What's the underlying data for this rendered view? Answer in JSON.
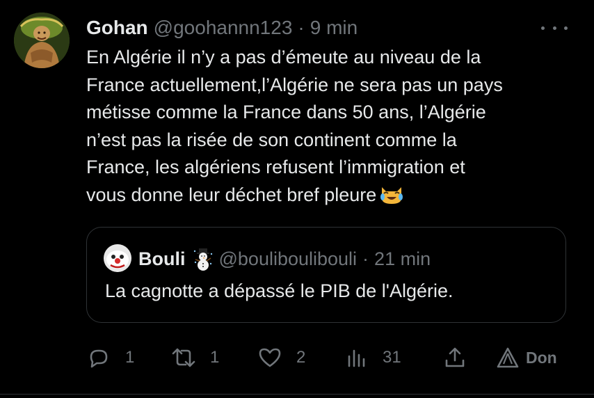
{
  "tweet": {
    "author_name": "Gohan",
    "author_handle": "@goohannn123",
    "separator": "·",
    "time": "9 min",
    "body_lines": [
      "En Algérie il n’y a pas d’émeute au niveau de la",
      "France actuellement,l’Algérie ne sera pas un pays",
      "métisse comme la France dans 50 ans, l’Algérie",
      "n’est pas la risée de son continent comme la",
      "France, les algériens refusent l’immigration et",
      "vous donne leur déchet bref pleure"
    ],
    "emoji": "tears-of-joy-cat-emoji"
  },
  "quote": {
    "author_name": "Bouli",
    "author_handle": "@bouliboulibouli",
    "separator": "·",
    "time": "21 min",
    "text": "La cagnotte a dépassé le PIB de l'Algérie."
  },
  "actions": {
    "replies": "1",
    "retweets": "1",
    "likes": "2",
    "views": "31",
    "promote_label": "Don"
  },
  "colors": {
    "background": "#000000",
    "text_primary": "#e7e9ea",
    "text_secondary": "#71767b",
    "border": "#2f3336"
  }
}
